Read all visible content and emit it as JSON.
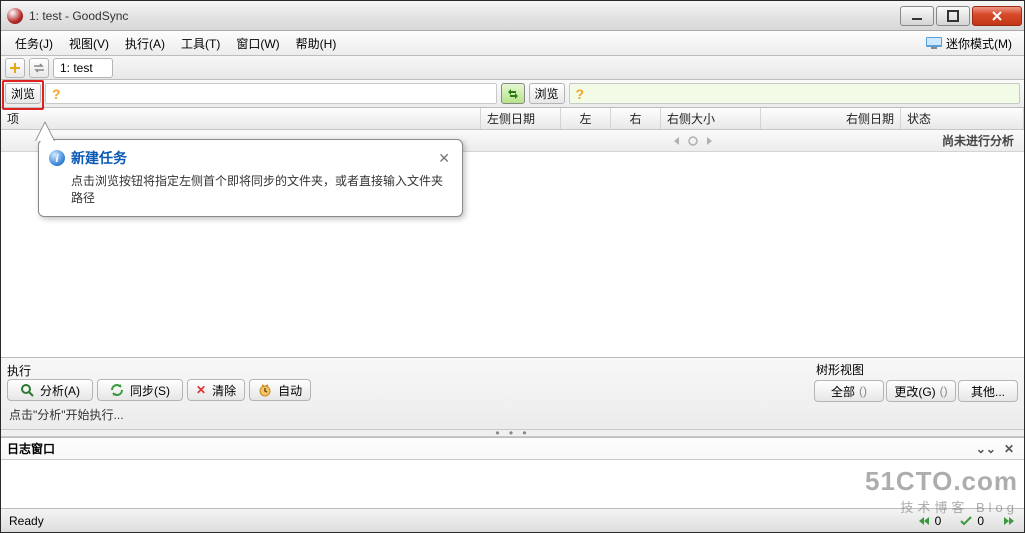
{
  "window": {
    "title": "1: test - GoodSync"
  },
  "menu": {
    "items": [
      "任务(J)",
      "视图(V)",
      "执行(A)",
      "工具(T)",
      "窗口(W)",
      "帮助(H)"
    ],
    "mini": "迷你模式(M)"
  },
  "tabs": {
    "name": "1: test"
  },
  "path": {
    "browse_left": "浏览",
    "browse_right": "浏览",
    "left_placeholder": "?",
    "right_placeholder": "?"
  },
  "columns": {
    "item": "项",
    "left_date": "左侧日期",
    "left": "左",
    "right": "右",
    "right_size": "右侧大小",
    "right_date": "右侧日期",
    "state": "状态"
  },
  "center_status": "尚未进行分析",
  "actions": {
    "section": "执行",
    "analyze": "分析(A)",
    "sync": "同步(S)",
    "clear": "清除",
    "auto": "自动",
    "hint": "点击\"分析\"开始执行..."
  },
  "tree": {
    "section": "树形视图",
    "all": "全部",
    "all_count": "()",
    "changes": "更改(G)",
    "changes_count": "()",
    "other": "其他..."
  },
  "log": {
    "title": "日志窗口"
  },
  "status": {
    "ready": "Ready",
    "c1": "0",
    "c2": "0"
  },
  "tooltip": {
    "title": "新建任务",
    "body": "点击浏览按钮将指定左侧首个即将同步的文件夹，或者直接输入文件夹路径"
  },
  "watermark": {
    "l1": "51CTO.com",
    "l2": "技术博客  Blog"
  }
}
